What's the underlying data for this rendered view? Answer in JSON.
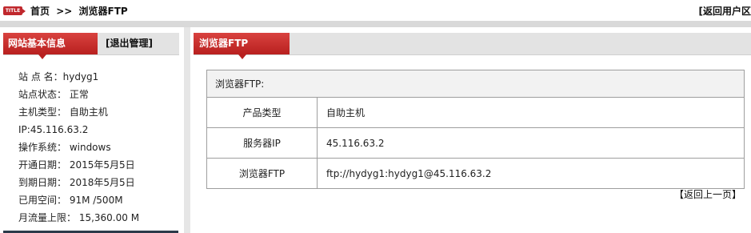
{
  "header": {
    "badge": "TITLE",
    "breadcrumb": [
      "首页",
      ">>",
      "浏览器FTP"
    ],
    "return_user": "[返回用户区"
  },
  "sidebar": {
    "tab_active": "网站基本信息",
    "tab_logout": "[退出管理]",
    "info": [
      "站 点 名：hydyg1",
      "站点状态： 正常",
      "主机类型： 自助主机",
      "IP:45.116.63.2",
      "操作系统： windows",
      "开通日期： 2015年5月5日",
      "到期日期： 2018年5月5日",
      "已用空间： 91M /500M",
      "月流量上限： 15,360.00 M"
    ]
  },
  "main": {
    "tab": "浏览器FTP",
    "table_caption": "浏览器FTP:",
    "rows": [
      {
        "label": "产品类型",
        "value": "自助主机"
      },
      {
        "label": "服务器IP",
        "value": "45.116.63.2"
      },
      {
        "label": "浏览器FTP",
        "value": "ftp://hydyg1:hydyg1@45.116.63.2"
      }
    ],
    "back": "【返回上一页】"
  }
}
